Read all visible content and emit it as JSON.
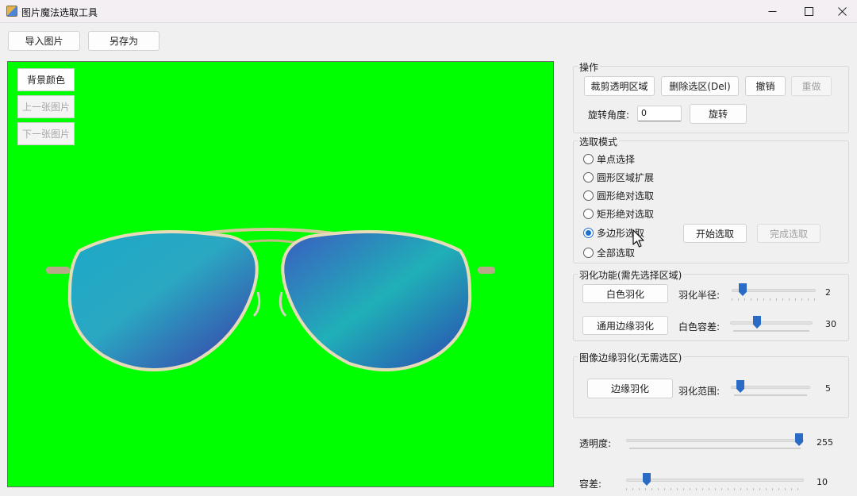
{
  "window": {
    "title": "图片魔法选取工具",
    "controls": {
      "minimize_icon": "minimize-icon",
      "maximize_icon": "maximize-icon",
      "close_icon": "close-icon"
    }
  },
  "toolbar": {
    "import_label": "导入图片",
    "save_as_label": "另存为"
  },
  "canvas": {
    "background_color": "#00ff00",
    "bg_color_label": "背景颜色",
    "prev_label": "上一张图片",
    "next_label": "下一张图片"
  },
  "operations": {
    "title": "操作",
    "crop_label": "裁剪透明区域",
    "delete_label": "删除选区(Del)",
    "undo_label": "撤销",
    "redo_label": "重做",
    "rotate_angle_label": "旋转角度:",
    "rotate_angle_value": "0",
    "rotate_label": "旋转"
  },
  "selection_mode": {
    "title": "选取模式",
    "options": [
      {
        "label": "单点选择",
        "selected": false
      },
      {
        "label": "圆形区域扩展",
        "selected": false
      },
      {
        "label": "圆形绝对选取",
        "selected": false
      },
      {
        "label": "矩形绝对选取",
        "selected": false
      },
      {
        "label": "多边形选取",
        "selected": true
      },
      {
        "label": "全部选取",
        "selected": false
      }
    ],
    "start_label": "开始选取",
    "finish_label": "完成选取"
  },
  "feather": {
    "title": "羽化功能(需先选择区域)",
    "white_feather_label": "白色羽化",
    "radius_label": "羽化半径:",
    "radius_value": "2",
    "edge_feather_label": "通用边缘羽化",
    "white_tolerance_label": "白色容差:",
    "white_tolerance_value": "30"
  },
  "image_edge": {
    "title": "图像边缘羽化(无需选区)",
    "edge_feather_label": "边缘羽化",
    "range_label": "羽化范围:",
    "range_value": "5"
  },
  "transparency": {
    "label": "透明度:",
    "value": "255"
  },
  "tolerance": {
    "label": "容差:",
    "value": "10"
  },
  "accent_color": "#2a6cc5"
}
